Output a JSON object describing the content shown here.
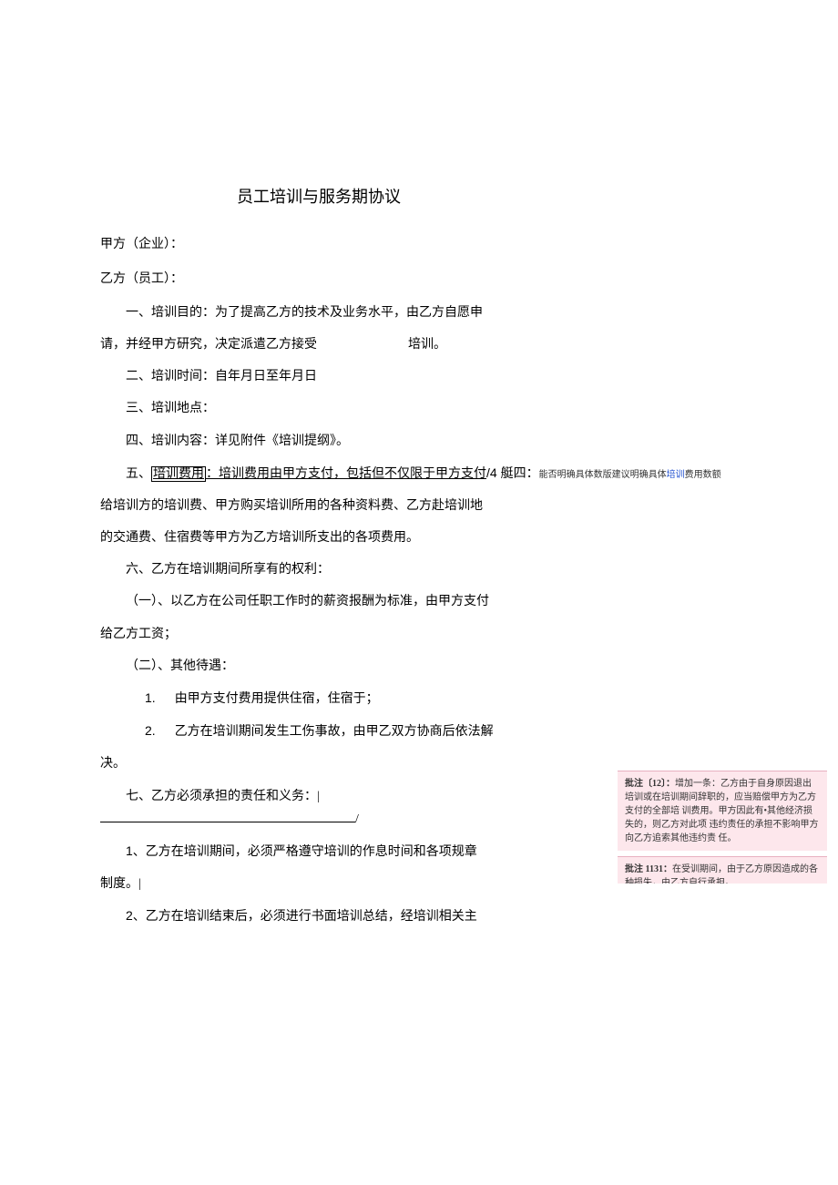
{
  "title": "员工培训与服务期协议",
  "parties": {
    "a": "甲方（企业）：",
    "b": "乙方（员工）："
  },
  "clauses": {
    "c1a": "一、培训目的：为了提高乙方的技术及业务水平，由乙方自愿申",
    "c1b_prefix": "请，并经甲方研究，决定派遣乙方接受",
    "c1b_suffix": "培训。",
    "c2": "二、培训时间：自年月日至年月日",
    "c3": "三、培训地点：",
    "c4": "四、培训内容：详见附件《培训提纲》。",
    "c5_prefix": "五、",
    "c5_u": "培训费用",
    "c5_mid": "：培训费用由甲方支付，包括但不仅限于甲方支付",
    "c5_num": "/4 艇四：",
    "c5_note_a": "能否明确具体数版建议明确具体",
    "c5_note_b": "培训",
    "c5_note_c": "费用数额",
    "c5b": "给培训方的培训费、甲方购买培训所用的各种资料费、乙方赴培训地",
    "c5c": "的交通费、住宿费等甲方为乙方培训所支出的各项费用。",
    "c6": "六、乙方在培训期间所享有的权利：",
    "c6_1a": "（一）、以乙方在公司任职工作时的薪资报酬为标准，由甲方支付",
    "c6_1b": "给乙方工资；",
    "c6_2": "（二）、其他待遇：",
    "c6_i1_num": "1.",
    "c6_i1": "由甲方支付费用提供住宿，住宿于；",
    "c6_i2_num": "2.",
    "c6_i2": "乙方在培训期间发生工伤事故，由甲乙双方协商后依法解",
    "c6_i2b": "决。",
    "c7_prefix": "七、乙方必须承担的责任和义务：",
    "c7_mark": "|",
    "c7_end": "/",
    "c7_1a": "1、乙方在培训期间，必须严格遵守培训的作息时间和各项规章",
    "c7_1b": "制度。",
    "c7_1c": "|",
    "c7_2": "2、乙方在培训结束后，必须进行书面培训总结，经培训相关主"
  },
  "comments": {
    "c1_label": "批注〔12〕：",
    "c1_text": "增加一条：乙方由于自身原因退出培训或在培训期间辞职的，应当赔偿甲方为乙方支付的全部培 训费用。甲方因此有•其他经济损失的，则乙方对此项 违约责任的承担不影响甲方向乙方追索其他违约责 任。",
    "c2_label": "批注 1131：",
    "c2_text": "在受训期间，由于乙方原因造成的各种损失，由乙方自行承担。"
  }
}
